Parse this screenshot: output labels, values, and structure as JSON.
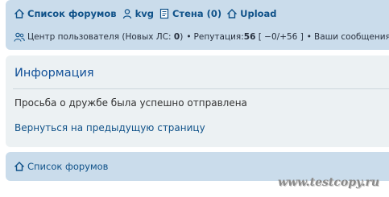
{
  "nav": {
    "forums": "Список форумов",
    "user": "kvg",
    "wall": "Стена (0)",
    "upload": "Upload"
  },
  "userbar": {
    "ucp": "Центр пользователя (Новых ЛС: ",
    "new_pm": "0",
    "close": ")",
    "bullet1": "•",
    "rep_label": "Репутация: ",
    "rep_value": "56",
    "rep_detail": "[ −0/+56 ]",
    "bullet2": "•",
    "more": "Ваши сообщения"
  },
  "panel": {
    "title": "Информация",
    "message": "Просьба о дружбе была успешно отправлена",
    "back_link": "Вернуться на предыдущую страницу"
  },
  "footer": {
    "forums": "Список форумов"
  },
  "watermark": "www.testcopy.ru",
  "colors": {
    "navbar_bg": "#cadceb",
    "panel_bg": "#ecf1f3",
    "link": "#105289"
  },
  "icons": [
    "home-icon",
    "user-icon",
    "wall-icon",
    "upload-icon",
    "users-icon"
  ]
}
